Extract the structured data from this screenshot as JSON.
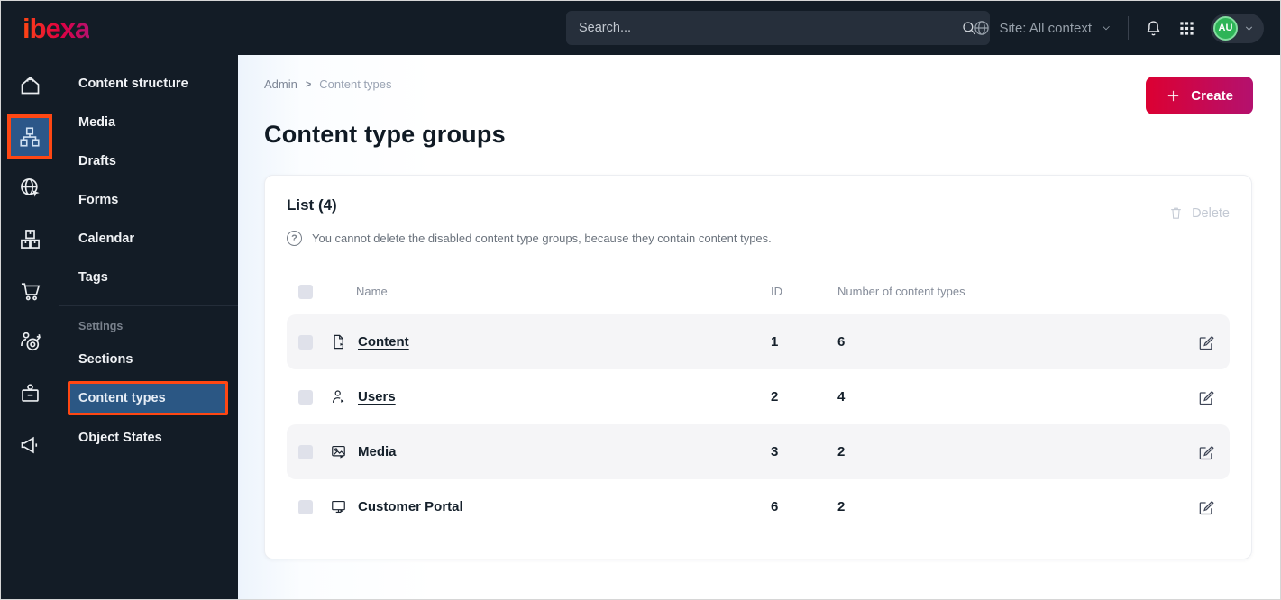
{
  "topbar": {
    "logo": "ibexa",
    "search": {
      "placeholder": "Search..."
    },
    "site_context": {
      "label": "Site: All context"
    },
    "avatar": {
      "initials": "AU"
    }
  },
  "sidebar": {
    "items": [
      {
        "label": "Content structure"
      },
      {
        "label": "Media"
      },
      {
        "label": "Drafts"
      },
      {
        "label": "Forms"
      },
      {
        "label": "Calendar"
      },
      {
        "label": "Tags"
      }
    ],
    "settings_group": {
      "label": "Settings",
      "items": [
        {
          "label": "Sections",
          "active": false
        },
        {
          "label": "Content types",
          "active": true
        },
        {
          "label": "Object States",
          "active": false
        }
      ]
    }
  },
  "main": {
    "breadcrumb": {
      "root": "Admin",
      "current": "Content types"
    },
    "create_button": {
      "label": "Create"
    },
    "page_title": "Content type groups",
    "card": {
      "title": "List (4)",
      "note": "You cannot delete the disabled content type groups, because they contain content types.",
      "delete_button": {
        "label": "Delete",
        "disabled": true
      },
      "table": {
        "headers": {
          "name": "Name",
          "id": "ID",
          "count": "Number of content types"
        },
        "rows": [
          {
            "icon": "content-file-icon",
            "name": "Content",
            "id": "1",
            "count": "6"
          },
          {
            "icon": "users-person-icon",
            "name": "Users",
            "id": "2",
            "count": "4"
          },
          {
            "icon": "media-image-icon",
            "name": "Media",
            "id": "3",
            "count": "2"
          },
          {
            "icon": "customer-portal-monitor-icon",
            "name": "Customer Portal",
            "id": "6",
            "count": "2"
          }
        ]
      }
    }
  },
  "colors": {
    "topbar_bg": "#131c26",
    "highlight_orange": "#ff4713",
    "active_blue": "#2b5784",
    "create_gradient_start": "#dc0032",
    "create_gradient_end": "#b4116e",
    "avatar_green": "#2eb457",
    "row_alt_bg": "#f5f5f7"
  }
}
